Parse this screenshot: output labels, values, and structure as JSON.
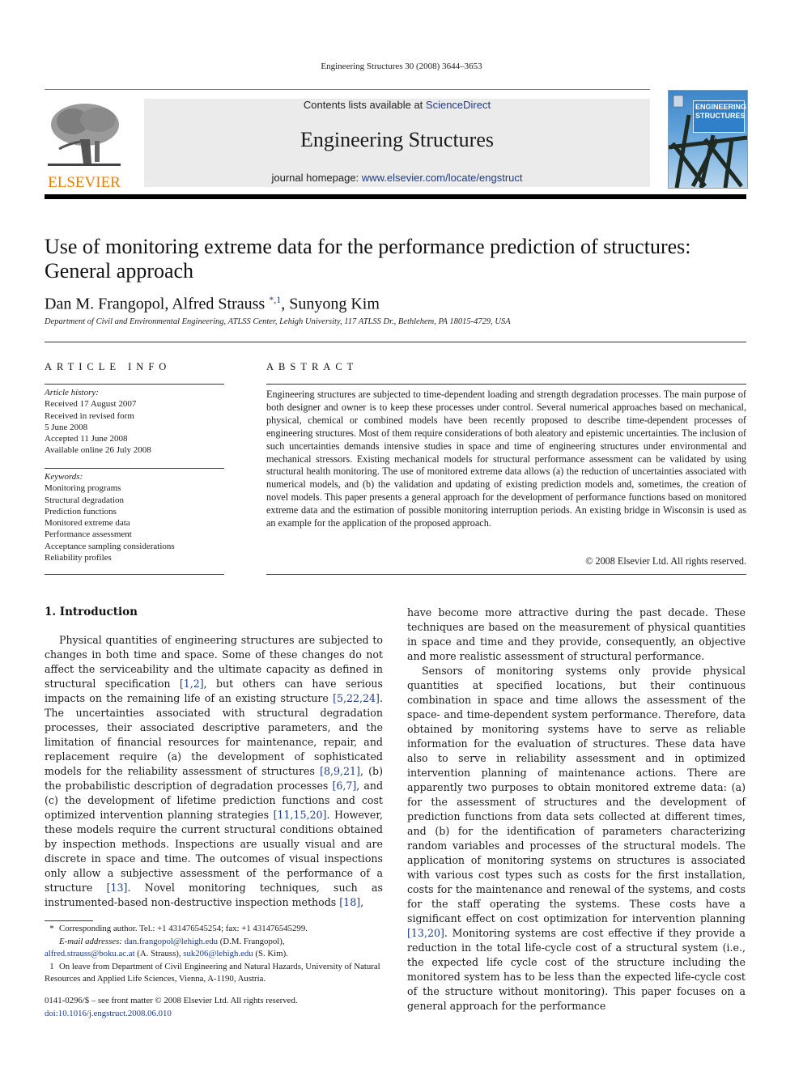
{
  "running_head": "Engineering Structures 30 (2008) 3644–3653",
  "masthead": {
    "publisher": "ELSEVIER",
    "contents_prefix": "Contents lists available at ",
    "contents_link": "ScienceDirect",
    "journal_name": "Engineering Structures",
    "homepage_prefix": "journal homepage: ",
    "homepage_link": "www.elsevier.com/locate/engstruct",
    "cover_title_line1": "ENGINEERING",
    "cover_title_line2": "STRUCTURES"
  },
  "article": {
    "title_line1": "Use of monitoring extreme data for the performance prediction of structures:",
    "title_line2": "General approach",
    "authors_before": "Dan M. Frangopol, Alfred Strauss ",
    "authors_sup": "*,1",
    "authors_after": ", Sunyong Kim",
    "affiliation": "Department of Civil and Environmental Engineering, ATLSS Center, Lehigh University, 117 ATLSS Dr., Bethlehem, PA 18015-4729, USA"
  },
  "article_info": {
    "heading": "ARTICLE INFO",
    "history_label": "Article history:",
    "history": [
      "Received 17 August 2007",
      "Received in revised form",
      "5 June 2008",
      "Accepted 11 June 2008",
      "Available online 26 July 2008"
    ],
    "keywords_label": "Keywords:",
    "keywords": [
      "Monitoring programs",
      "Structural degradation",
      "Prediction functions",
      "Monitored extreme data",
      "Performance assessment",
      "Acceptance sampling considerations",
      "Reliability profiles"
    ]
  },
  "abstract": {
    "heading": "ABSTRACT",
    "text": "Engineering structures are subjected to time-dependent loading and strength degradation processes. The main purpose of both designer and owner is to keep these processes under control. Several numerical approaches based on mechanical, physical, chemical or combined models have been recently proposed to describe time-dependent processes of engineering structures. Most of them require considerations of both aleatory and epistemic uncertainties. The inclusion of such uncertainties demands intensive studies in space and time of engineering structures under environmental and mechanical stressors. Existing mechanical models for structural performance assessment can be validated by using structural health monitoring. The use of monitored extreme data allows (a) the reduction of uncertainties associated with numerical models, and (b) the validation and updating of existing prediction models and, sometimes, the creation of novel models. This paper presents a general approach for the development of performance functions based on monitored extreme data and the estimation of possible monitoring interruption periods. An existing bridge in Wisconsin is used as an example for the application of the proposed approach.",
    "copyright": "© 2008 Elsevier Ltd. All rights reserved."
  },
  "intro": {
    "heading": "1.  Introduction",
    "left_p1_segments": [
      {
        "t": "Physical quantities of engineering structures are subjected to changes in both time and space. Some of these changes do not affect the serviceability and the ultimate capacity as defined in structural specification "
      },
      {
        "t": "[1,2]",
        "ref": true
      },
      {
        "t": ", but others can have serious impacts on the remaining life of an existing structure "
      },
      {
        "t": "[5,22,24]",
        "ref": true
      },
      {
        "t": ". The uncertainties associated with structural degradation processes, their associated descriptive parameters, and the limitation of financial resources for maintenance, repair, and replacement require (a) the development of sophisticated models for the reliability assessment of structures "
      },
      {
        "t": "[8,9,21]",
        "ref": true
      },
      {
        "t": ", (b) the probabilistic description of degradation processes "
      },
      {
        "t": "[6,7]",
        "ref": true
      },
      {
        "t": ", and (c) the development of lifetime prediction functions and cost optimized intervention planning strategies "
      },
      {
        "t": "[11,15,20]",
        "ref": true
      },
      {
        "t": ". However, these models require the current structural conditions obtained by inspection methods. Inspections are usually visual and are discrete in space and time. The outcomes of visual inspections only allow a subjective assessment of the performance of a structure "
      },
      {
        "t": "[13]",
        "ref": true
      },
      {
        "t": ". Novel monitoring techniques, such as instrumented-based non-destructive inspection methods "
      },
      {
        "t": "[18]",
        "ref": true
      },
      {
        "t": ","
      }
    ],
    "right_p1": "have become more attractive during the past decade. These techniques are based on the measurement of physical quantities in space and time and they provide, consequently, an objective and more realistic assessment of structural performance.",
    "right_p2_segments": [
      {
        "t": "Sensors of monitoring systems only provide physical quantities at specified locations, but their continuous combination in space and time allows the assessment of the space- and time-dependent system performance. Therefore, data obtained by monitoring systems have to serve as reliable information for the evaluation of structures. These data have also to serve in reliability assessment and in optimized intervention planning of maintenance actions. There are apparently two purposes to obtain monitored extreme data: (a) for the assessment of structures and the development of prediction functions from data sets collected at different times, and (b) for the identification of parameters characterizing random variables and processes of the structural models. The application of monitoring systems on structures is associated with various cost types such as costs for the first installation, costs for the maintenance and renewal of the systems, and costs for the staff operating the systems. These costs have a significant effect on cost optimization for intervention planning "
      },
      {
        "t": "[13,20]",
        "ref": true
      },
      {
        "t": ". Monitoring systems are cost effective if they provide a reduction in the total life-cycle cost of a structural system (i.e., the expected life cycle cost of the structure including the monitored system has to be less than the expected life-cycle cost of the structure without monitoring). This paper focuses on a general approach for the performance"
      }
    ]
  },
  "footnotes": {
    "star_mark": "*",
    "corresponding": "Corresponding author. Tel.: +1 431476545254; fax: +1 431476545299.",
    "email_label": "E-mail addresses:",
    "emails": [
      {
        "address": "dan.frangopol@lehigh.edu",
        "name": "(D.M. Frangopol),"
      },
      {
        "address": "alfred.strauss@boku.ac.at",
        "name": "(A. Strauss),"
      },
      {
        "address": "suk206@lehigh.edu",
        "name": "(S. Kim)."
      }
    ],
    "one_mark": "1",
    "on_leave": "On leave from Department of Civil Engineering and Natural Hazards, University of Natural Resources and Applied Life Sciences, Vienna, A-1190, Austria.",
    "front_matter": "0141-0296/$ – see front matter © 2008 Elsevier Ltd. All rights reserved.",
    "doi": "doi:10.1016/j.engstruct.2008.06.010"
  },
  "colors": {
    "link": "#1d3b8f",
    "elsevier_orange": "#f07d00",
    "masthead_bg": "#ebebeb"
  }
}
